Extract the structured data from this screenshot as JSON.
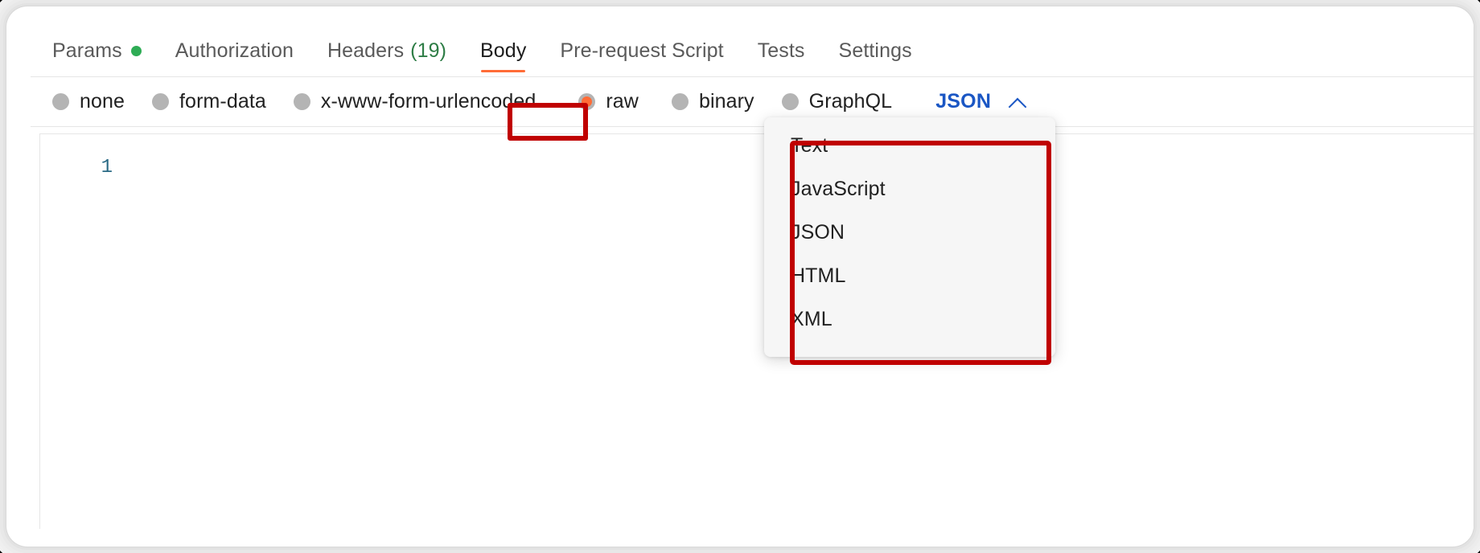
{
  "request_tabs": [
    {
      "label": "Params",
      "indicator": "green-dot",
      "active": false
    },
    {
      "label": "Authorization",
      "active": false
    },
    {
      "label": "Headers",
      "count": "(19)",
      "active": false
    },
    {
      "label": "Body",
      "active": true
    },
    {
      "label": "Pre-request Script",
      "active": false
    },
    {
      "label": "Tests",
      "active": false
    },
    {
      "label": "Settings",
      "active": false
    }
  ],
  "body_types": [
    {
      "label": "none",
      "selected": false
    },
    {
      "label": "form-data",
      "selected": false
    },
    {
      "label": "x-www-form-urlencoded",
      "selected": false
    },
    {
      "label": "raw",
      "selected": true
    },
    {
      "label": "binary",
      "selected": false
    },
    {
      "label": "GraphQL",
      "selected": false
    }
  ],
  "format_dropdown": {
    "selected": "JSON",
    "chevron": "chevron-up-icon",
    "expanded": true,
    "options": [
      "Text",
      "JavaScript",
      "JSON",
      "HTML",
      "XML"
    ]
  },
  "editor": {
    "line_numbers": [
      "1"
    ],
    "content": ""
  },
  "colors": {
    "accent_orange": "#ff6c37",
    "link_blue": "#1a56c4",
    "status_green": "#2eac55",
    "count_green": "#2e7d46",
    "annotation_red": "#c00000",
    "radio_gray": "#b4b4b4",
    "line_number": "#2a6a85"
  }
}
